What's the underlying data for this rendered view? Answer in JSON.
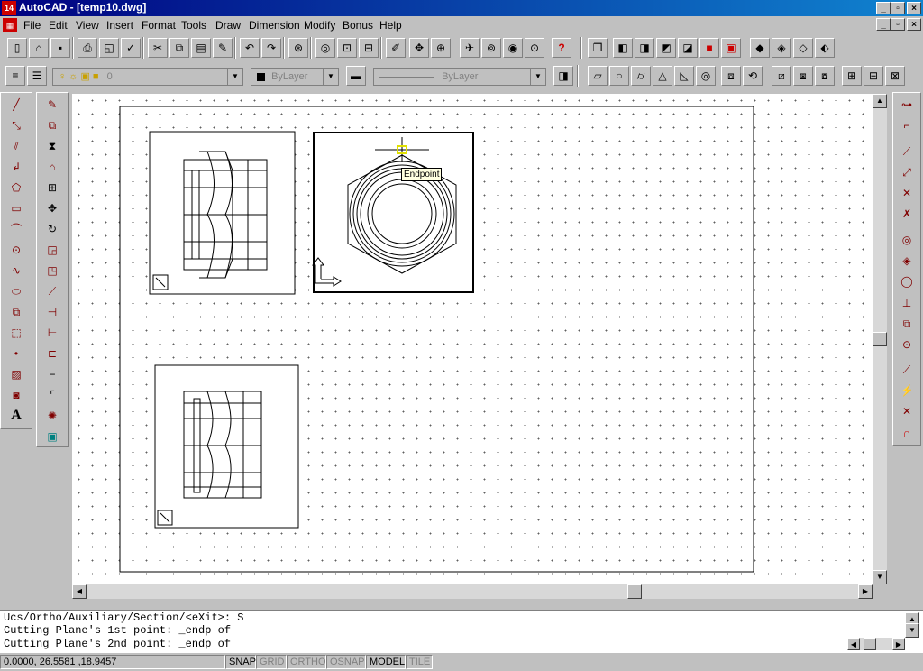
{
  "window": {
    "app_icon": "14",
    "title": "AutoCAD - [temp10.dwg]",
    "minimize": "_",
    "restore": "▫",
    "close": "×"
  },
  "menu": {
    "items": [
      "File",
      "Edit",
      "View",
      "Insert",
      "Format",
      "Tools",
      "Draw",
      "Dimension",
      "Modify",
      "Bonus",
      "Help"
    ]
  },
  "layer_toolbar": {
    "layer_name": "0",
    "color": "ByLayer",
    "linetype": "ByLayer"
  },
  "drawing": {
    "snap_tooltip": "Endpoint"
  },
  "command": {
    "lines": [
      "Ucs/Ortho/Auxiliary/Section/<eXit>: S",
      "Cutting Plane's 1st point: _endp of",
      "Cutting Plane's 2nd point: _endp of"
    ]
  },
  "status": {
    "coords": "0.0000,  26.5581 ,18.9457",
    "toggles": [
      {
        "label": "SNAP",
        "on": true
      },
      {
        "label": "GRID",
        "on": false
      },
      {
        "label": "ORTHO",
        "on": false
      },
      {
        "label": "OSNAP",
        "on": false
      },
      {
        "label": "MODEL",
        "on": true
      },
      {
        "label": "TILE",
        "on": false
      }
    ]
  },
  "colors": {
    "title_start": "#000080",
    "title_end": "#1084d0",
    "face": "#c0c0c0",
    "snap_marker": "#ffff00",
    "icon_red": "#800000"
  }
}
